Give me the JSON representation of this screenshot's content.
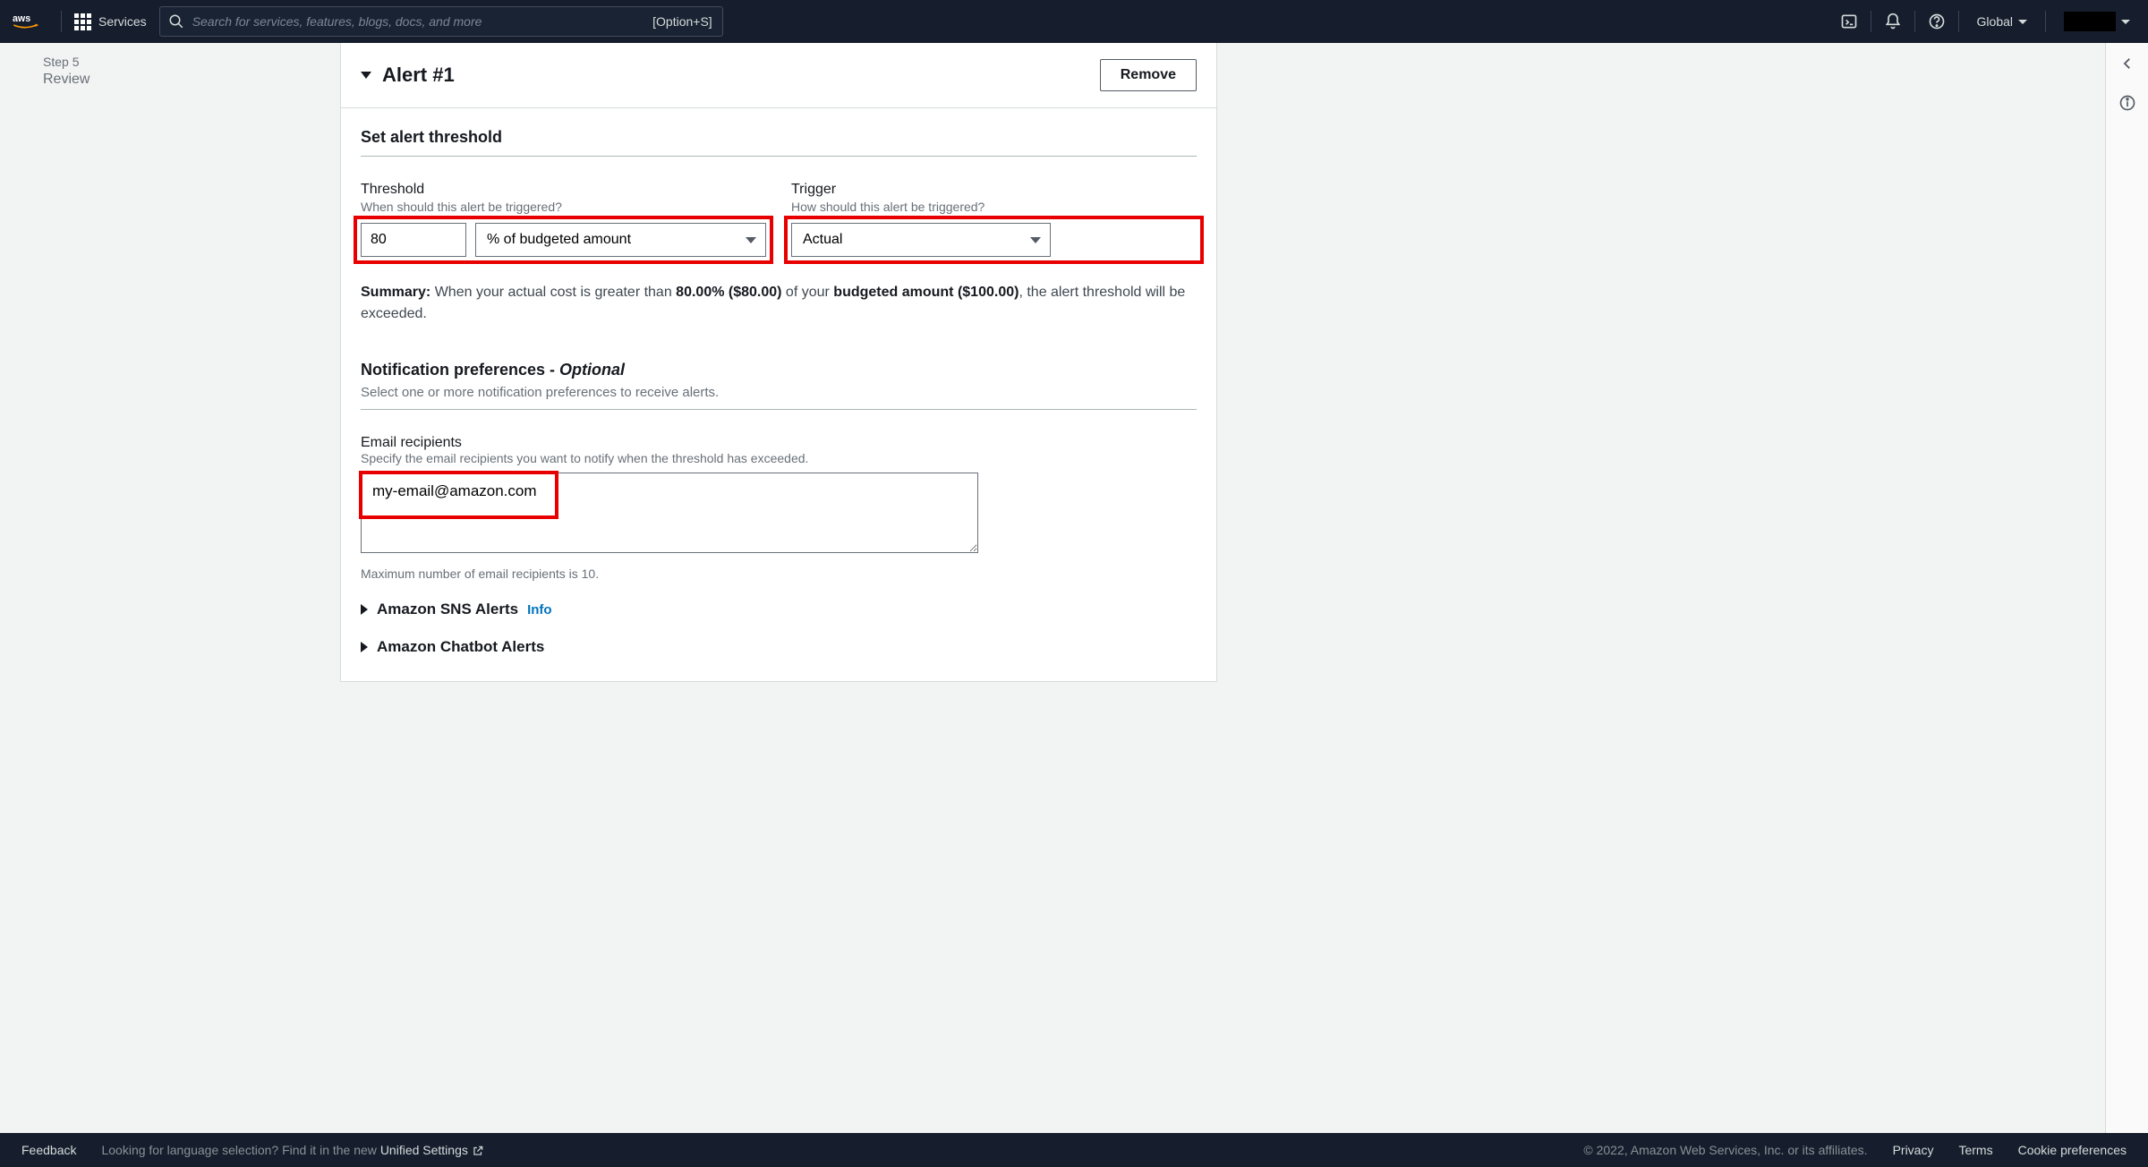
{
  "topnav": {
    "services": "Services",
    "searchPlaceholder": "Search for services, features, blogs, docs, and more",
    "searchKbd": "[Option+S]",
    "region": "Global"
  },
  "sidebar": {
    "stepLabel": "Step 5",
    "stepName": "Review"
  },
  "alert": {
    "title": "Alert #1",
    "removeLabel": "Remove",
    "sectionTitle": "Set alert threshold",
    "threshold": {
      "label": "Threshold",
      "help": "When should this alert be triggered?",
      "value": "80",
      "unit": "% of budgeted amount"
    },
    "trigger": {
      "label": "Trigger",
      "help": "How should this alert be triggered?",
      "value": "Actual"
    },
    "summary": {
      "prefix": "Summary: ",
      "t1": "When your actual cost is greater than ",
      "pct": "80.00% ($80.00)",
      "t2": " of your ",
      "budget": "budgeted amount ($100.00)",
      "t3": ", the alert threshold will be exceeded."
    },
    "notif": {
      "title": "Notification preferences - ",
      "optional": "Optional",
      "sub": "Select one or more notification preferences to receive alerts."
    },
    "email": {
      "label": "Email recipients",
      "help": "Specify the email recipients you want to notify when the threshold has exceeded.",
      "value": "my-email@amazon.com",
      "hint": "Maximum number of email recipients is 10."
    },
    "sns": {
      "label": "Amazon SNS Alerts",
      "info": "Info"
    },
    "chatbot": {
      "label": "Amazon Chatbot Alerts"
    }
  },
  "footer": {
    "feedback": "Feedback",
    "langMsg": "Looking for language selection? Find it in the new ",
    "unified": "Unified Settings",
    "copyright": "© 2022, Amazon Web Services, Inc. or its affiliates.",
    "privacy": "Privacy",
    "terms": "Terms",
    "cookies": "Cookie preferences"
  }
}
